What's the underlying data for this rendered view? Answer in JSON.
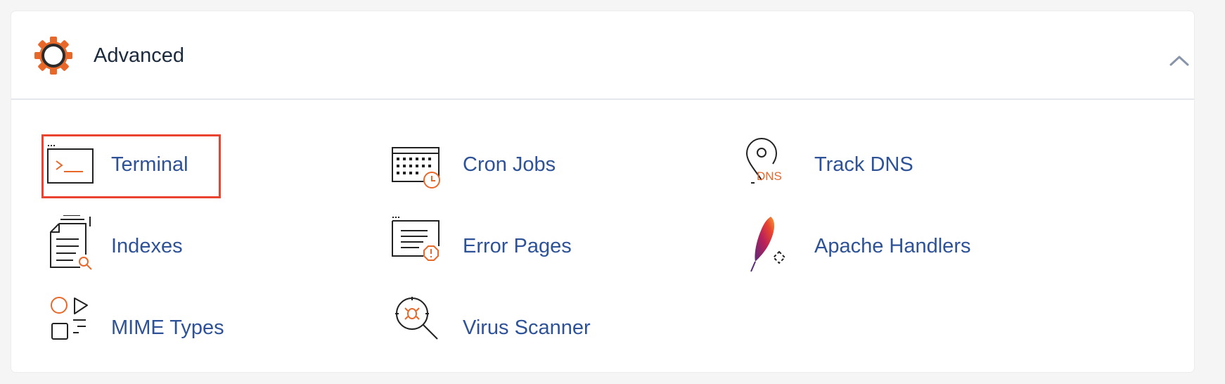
{
  "section": {
    "title": "Advanced",
    "header_icon": "gear-icon",
    "collapse_icon": "chevron-up-icon",
    "accent_color": "#e8682a",
    "link_color": "#2e5297"
  },
  "tools": [
    {
      "label": "Terminal",
      "icon": "terminal-icon",
      "highlighted": true
    },
    {
      "label": "Cron Jobs",
      "icon": "cron-calendar-icon"
    },
    {
      "label": "Track DNS",
      "icon": "map-pin-dns-icon",
      "icon_text": "DNS"
    },
    {
      "label": "Indexes",
      "icon": "document-search-icon"
    },
    {
      "label": "Error Pages",
      "icon": "error-page-icon"
    },
    {
      "label": "Apache Handlers",
      "icon": "apache-feather-icon"
    },
    {
      "label": "MIME Types",
      "icon": "shapes-icon"
    },
    {
      "label": "Virus Scanner",
      "icon": "virus-magnifier-icon"
    }
  ],
  "highlight_color": "#e8442f"
}
